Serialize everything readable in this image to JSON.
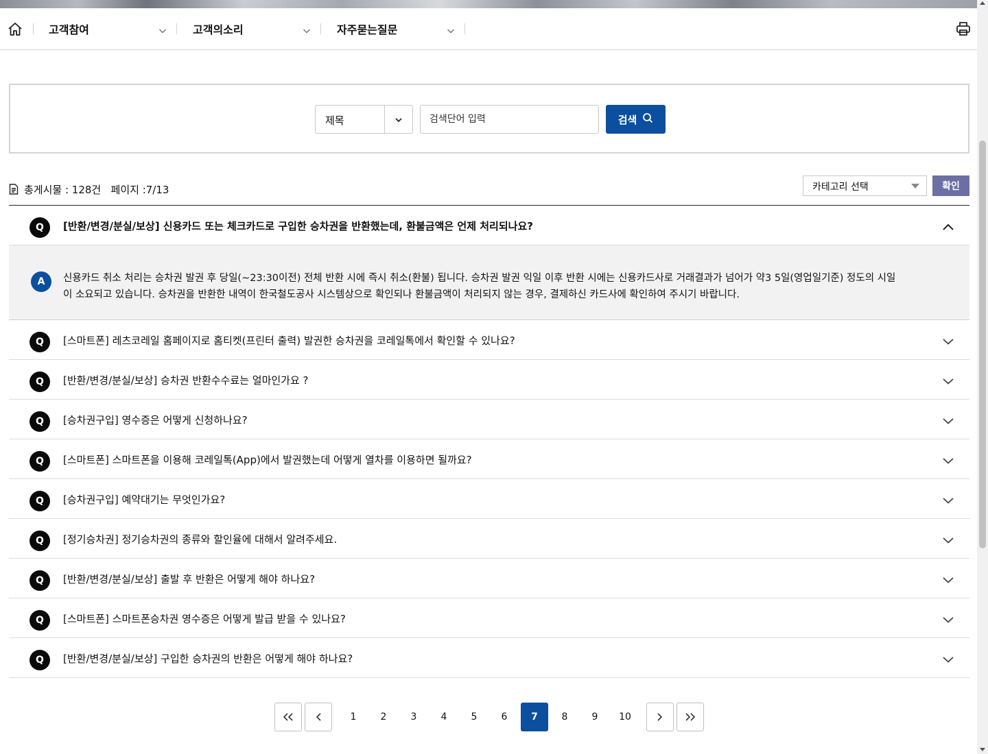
{
  "nav": {
    "items": [
      {
        "label": "고객참여"
      },
      {
        "label": "고객의소리"
      },
      {
        "label": "자주묻는질문"
      }
    ]
  },
  "search": {
    "field_selected": "제목",
    "placeholder": "검색단어 입력",
    "button_label": "검색"
  },
  "summary": {
    "total_text": "총게시물 : 128건   페이지 :7/13"
  },
  "category": {
    "selected": "카테고리 선택",
    "confirm_label": "확인"
  },
  "faq": {
    "q_badge": "Q",
    "a_badge": "A",
    "open_question": "[반환/변경/분실/보상] 신용카드 또는 체크카드로 구입한 승차권을 반환했는데, 환불금액은 언제 처리되나요?",
    "open_answer": "신용카드 취소 처리는 승차권 발권 후 당일(~23:30이전) 전체 반환 시에 즉시 취소(환불) 됩니다. 승차권 발권 익일 이후 반환 시에는 신용카드사로 거래결과가 넘어가 약3 5일(영업일기준) 정도의 시일이 소요되고 있습니다. 승차권을 반환한 내역이 한국철도공사 시스템상으로 확인되나 환불금액이 처리되지 않는 경우, 결제하신 카드사에 확인하여 주시기 바랍니다.",
    "questions": [
      "[스마트폰] 레츠코레일 홈페이지로 홈티켓(프린터 출력) 발권한 승차권을 코레일톡에서 확인할 수 있나요?",
      "[반환/변경/분실/보상] 승차권 반환수수료는 얼마인가요 ?",
      "[승차권구입] 영수증은 어떻게 신청하나요?",
      "[스마트폰] 스마트폰을 이용해 코레일톡(App)에서 발권했는데 어떻게 열차를 이용하면 될까요?",
      "[승차권구입] 예약대기는 무엇인가요?",
      "[정기승차권] 정기승차권의 종류와 할인율에 대해서 알려주세요.",
      "[반환/변경/분실/보상] 출발 후 반환은 어떻게 해야 하나요?",
      "[스마트폰] 스마트폰승차권 영수증은 어떻게 발급 받을 수 있나요?",
      "[반환/변경/분실/보상] 구입한 승차권의 반환은 어떻게 해야 하나요?"
    ]
  },
  "pagination": {
    "pages": [
      "1",
      "2",
      "3",
      "4",
      "5",
      "6",
      "7",
      "8",
      "9",
      "10"
    ],
    "current": "7"
  },
  "colors": {
    "primary": "#0b4f9e",
    "confirm": "#6b6fa3",
    "answer_bg": "#f2f2f2"
  }
}
